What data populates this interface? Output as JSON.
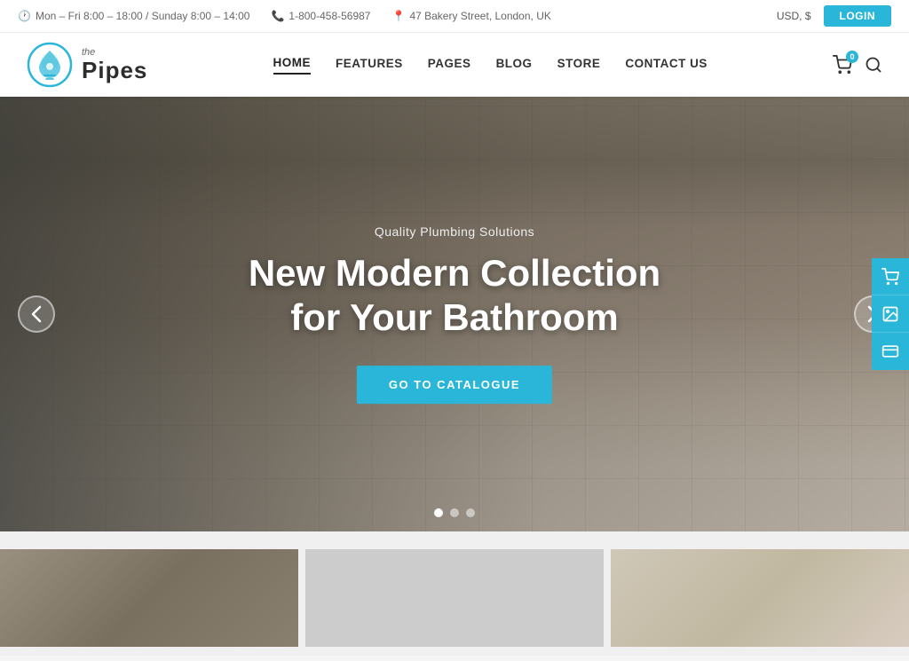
{
  "topbar": {
    "hours": "Mon – Fri 8:00 – 18:00 / Sunday 8:00 – 14:00",
    "phone": "1-800-458-56987",
    "address": "47 Bakery Street, London, UK",
    "currency": "USD, $",
    "login_label": "LOGIN"
  },
  "header": {
    "logo_the": "the",
    "logo_name": "Pipes",
    "nav": [
      {
        "label": "HOME",
        "active": true
      },
      {
        "label": "FEATURES",
        "active": false
      },
      {
        "label": "PAGES",
        "active": false
      },
      {
        "label": "BLOG",
        "active": false
      },
      {
        "label": "STORE",
        "active": false
      },
      {
        "label": "CONTACT US",
        "active": false
      }
    ],
    "cart_count": "0"
  },
  "hero": {
    "subtitle": "Quality Plumbing Solutions",
    "title_line1": "New Modern Collection",
    "title_line2": "for Your Bathroom",
    "cta_label": "GO TO CATALOGUE",
    "dots": [
      {
        "active": true
      },
      {
        "active": false
      },
      {
        "active": false
      }
    ],
    "arrow_left": "‹",
    "arrow_right": "›"
  },
  "side_icons": [
    {
      "name": "cart-side-icon",
      "symbol": "🛒"
    },
    {
      "name": "image-side-icon",
      "symbol": "🖼"
    },
    {
      "name": "card-side-icon",
      "symbol": "💳"
    }
  ]
}
